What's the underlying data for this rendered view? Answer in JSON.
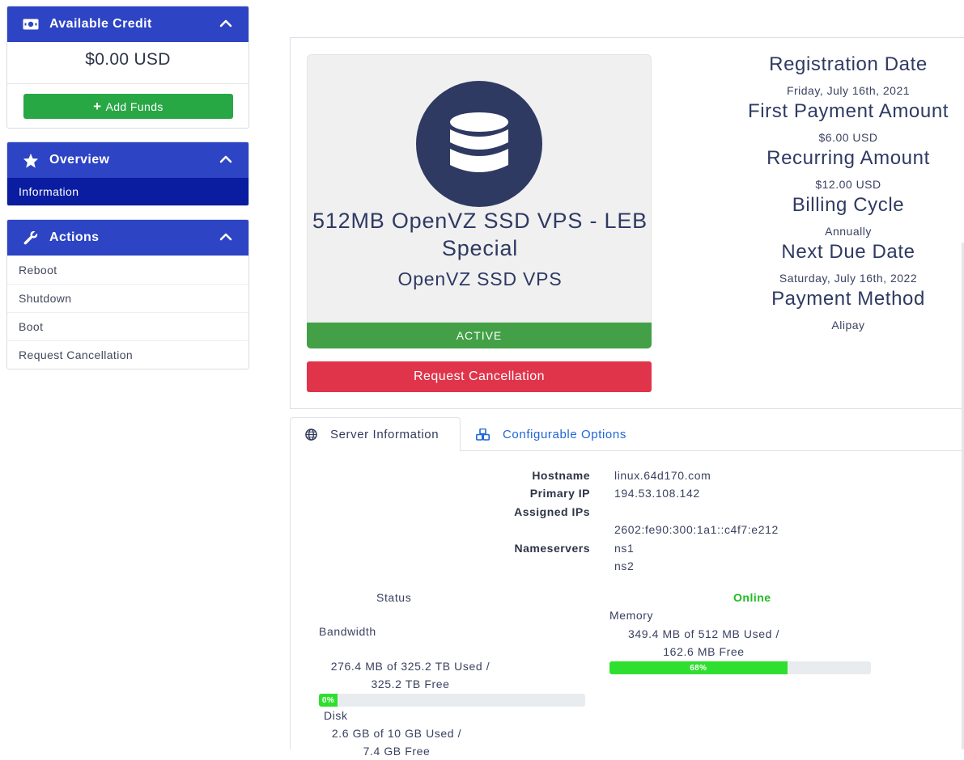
{
  "sidebar": {
    "credit": {
      "title": "Available Credit",
      "amount": "$0.00 USD",
      "add_funds_label": "Add Funds"
    },
    "overview": {
      "title": "Overview",
      "items": [
        {
          "label": "Information"
        }
      ]
    },
    "actions": {
      "title": "Actions",
      "items": [
        {
          "label": "Reboot"
        },
        {
          "label": "Shutdown"
        },
        {
          "label": "Boot"
        },
        {
          "label": "Request Cancellation"
        }
      ]
    }
  },
  "product": {
    "name": "512MB OpenVZ SSD VPS - LEB Special",
    "group": "OpenVZ SSD VPS",
    "status": "ACTIVE",
    "cancel_label": "Request Cancellation",
    "icon": "database-icon"
  },
  "billing": [
    {
      "label": "Registration Date",
      "value": "Friday, July 16th, 2021"
    },
    {
      "label": "First Payment Amount",
      "value": "$6.00 USD"
    },
    {
      "label": "Recurring Amount",
      "value": "$12.00 USD"
    },
    {
      "label": "Billing Cycle",
      "value": "Annually"
    },
    {
      "label": "Next Due Date",
      "value": "Saturday, July 16th, 2022"
    },
    {
      "label": "Payment Method",
      "value": "Alipay"
    }
  ],
  "tabs": [
    {
      "label": "Server Information",
      "icon": "globe-icon",
      "active": true
    },
    {
      "label": "Configurable Options",
      "icon": "cubes-icon",
      "active": false
    }
  ],
  "server": {
    "hostname_label": "Hostname",
    "hostname": "linux.64d170.com",
    "primary_ip_label": "Primary IP",
    "primary_ip": "194.53.108.142",
    "assigned_ips_label": "Assigned IPs",
    "assigned_ip": "2602:fe90:300:1a1::c4f7:e212",
    "nameservers_label": "Nameservers",
    "ns1": "ns1",
    "ns2": "ns2",
    "status_label": "Status",
    "status_value": "Online"
  },
  "resources": {
    "bandwidth": {
      "title": "Bandwidth",
      "line1": "276.4 MB of 325.2 TB Used /",
      "line2": "325.2 TB Free",
      "percent_label": "0%",
      "percent": 0
    },
    "memory": {
      "title": "Memory",
      "line1": "349.4 MB of 512 MB Used /",
      "line2": "162.6 MB Free",
      "percent_label": "68%",
      "percent": 68
    },
    "disk": {
      "title": "Disk",
      "line1": "2.6 GB of 10 GB Used /",
      "line2": "7.4 GB Free"
    }
  },
  "colors": {
    "header_blue": "#2d44c4",
    "active_nav": "#0a1ca0",
    "add_funds_green": "#28a745",
    "status_green": "#43a047",
    "cancel_red": "#e0344a",
    "online_green": "#22bb22",
    "progress_green": "#2fdf2f",
    "link_blue": "#1f65d6"
  }
}
